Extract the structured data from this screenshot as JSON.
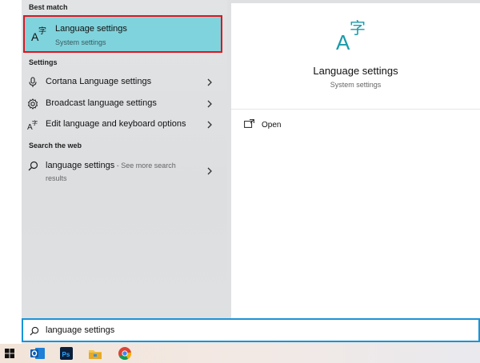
{
  "sections": {
    "best_match": "Best match",
    "settings": "Settings",
    "search_web": "Search the web"
  },
  "best_match_item": {
    "title": "Language settings",
    "subtitle": "System settings",
    "icon": "language-icon"
  },
  "settings_items": [
    {
      "label": "Cortana Language settings",
      "icon": "microphone-icon"
    },
    {
      "label": "Broadcast language settings",
      "icon": "gear-icon"
    },
    {
      "label": "Edit language and keyboard options",
      "icon": "language-icon"
    }
  ],
  "web_item": {
    "label": "language settings",
    "hint": " - See more search",
    "hint2": "results",
    "icon": "search-icon"
  },
  "preview": {
    "title": "Language settings",
    "subtitle": "System settings",
    "icon": "language-icon"
  },
  "actions": {
    "open": "Open"
  },
  "search": {
    "value": "language settings",
    "icon": "search-icon"
  },
  "taskbar": {
    "items": [
      "windows-start-icon",
      "outlook-icon",
      "photoshop-icon",
      "file-explorer-icon",
      "chrome-icon"
    ]
  },
  "colors": {
    "highlight": "#7fd3dc",
    "selection_border": "#e0141e",
    "accent": "#1a94d8",
    "language_icon": "#1a9bab"
  }
}
